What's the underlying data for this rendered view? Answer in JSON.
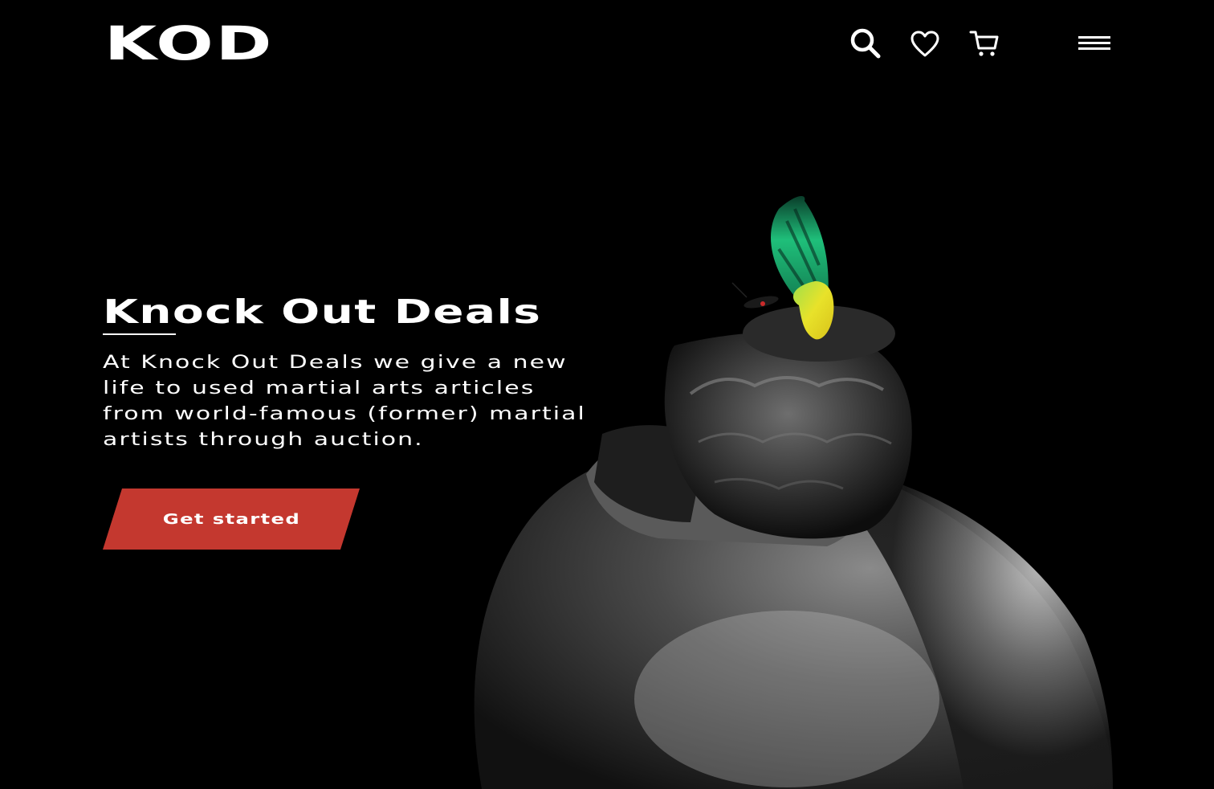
{
  "header": {
    "logo": "KOD",
    "icons": [
      "search-icon",
      "heart-icon",
      "cart-icon",
      "menu-icon"
    ]
  },
  "hero": {
    "title": "Knock Out Deals",
    "description": "At Knock Out Deals we give a new life to used martial arts articles from world-famous (former) martial artists through auction.",
    "cta_label": "Get started"
  },
  "colors": {
    "background": "#000000",
    "text": "#ffffff",
    "accent": "#c4382f",
    "butterfly_green": "#1fbf7a",
    "butterfly_yellow": "#e8e22a"
  }
}
